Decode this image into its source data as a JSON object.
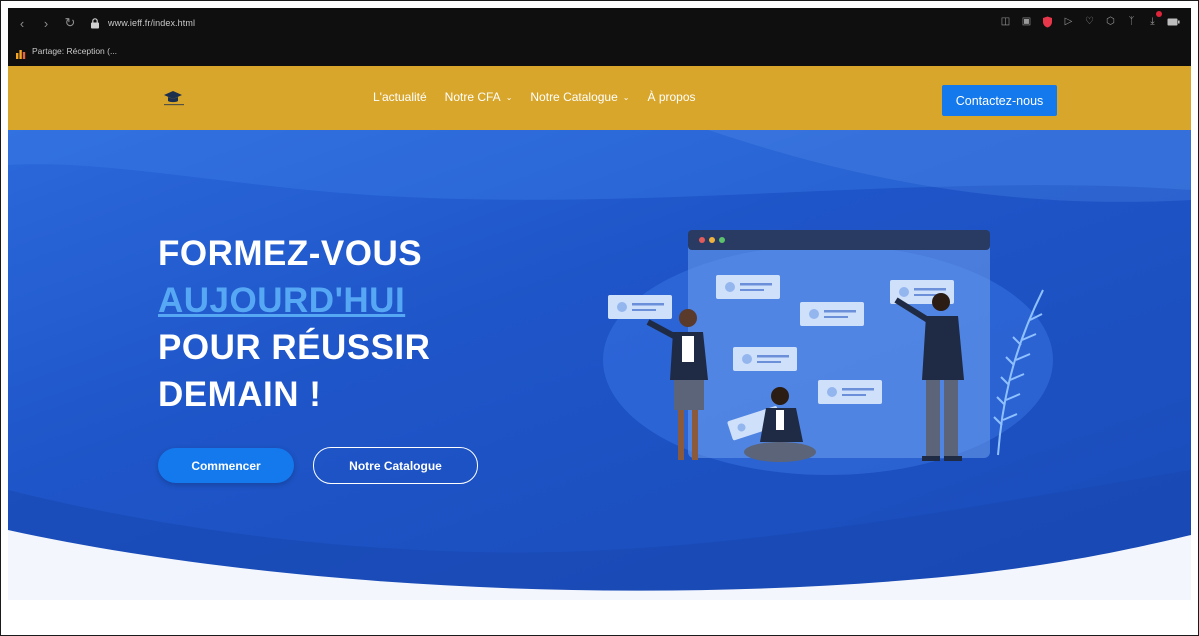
{
  "browser": {
    "url": "www.ieff.fr/index.html",
    "bookmark": "Partage: Réception (..."
  },
  "site": {
    "nav": [
      {
        "label": "L'actualité",
        "has_dropdown": false
      },
      {
        "label": "Notre CFA",
        "has_dropdown": true
      },
      {
        "label": "Notre Catalogue",
        "has_dropdown": true
      },
      {
        "label": "À propos",
        "has_dropdown": false
      }
    ],
    "contact_label": "Contactez-nous"
  },
  "hero": {
    "line1": "FORMEZ-VOUS",
    "line2": "AUJOURD'HUI",
    "line3": "POUR RÉUSSIR",
    "line4": "DEMAIN !",
    "primary_label": "Commencer",
    "secondary_label": "Notre Catalogue"
  },
  "colors": {
    "header_bg": "#d8a62a",
    "hero_blue": "#1e55c8",
    "accent_button": "#1479ec",
    "highlight_text": "#57a8f4"
  }
}
